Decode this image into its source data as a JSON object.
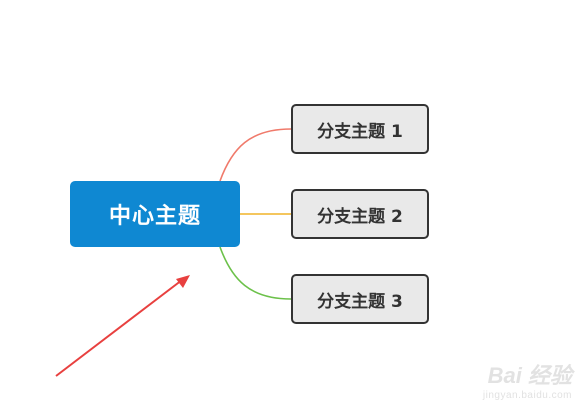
{
  "colors": {
    "central_fill": "#0f88d2",
    "branch_fill": "#e9e9e9",
    "branch_border": "#333333",
    "line_1": "#f07a6b",
    "line_2": "#f0b429",
    "line_3": "#6cc14a",
    "arrow": "#e8403f"
  },
  "mindmap": {
    "central_topic": "中心主题",
    "branches": [
      {
        "label": "分支主题 1"
      },
      {
        "label": "分支主题 2"
      },
      {
        "label": "分支主题 3"
      }
    ]
  },
  "watermark": {
    "brand": "Bai 经验",
    "url": "jingyan.baidu.com"
  }
}
